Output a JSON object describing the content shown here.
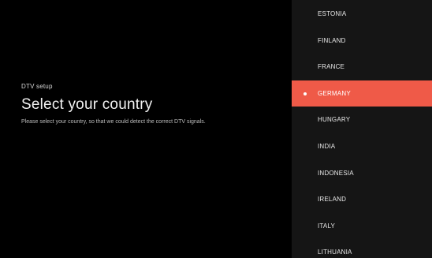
{
  "setup": {
    "overline": "DTV setup",
    "title": "Select your country",
    "description": "Please select your country, so that we could detect the correct DTV signals."
  },
  "countries": [
    {
      "label": "ESTONIA",
      "selected": false
    },
    {
      "label": "FINLAND",
      "selected": false
    },
    {
      "label": "FRANCE",
      "selected": false
    },
    {
      "label": "GERMANY",
      "selected": true
    },
    {
      "label": "HUNGARY",
      "selected": false
    },
    {
      "label": "INDIA",
      "selected": false
    },
    {
      "label": "INDONESIA",
      "selected": false
    },
    {
      "label": "IRELAND",
      "selected": false
    },
    {
      "label": "ITALY",
      "selected": false
    },
    {
      "label": "LITHUANIA",
      "selected": false
    }
  ],
  "colors": {
    "accent": "#ef5a48",
    "list_background": "#151515",
    "screen_background": "#000000"
  },
  "icons": {
    "selected_marker": "selected-dot-icon"
  }
}
